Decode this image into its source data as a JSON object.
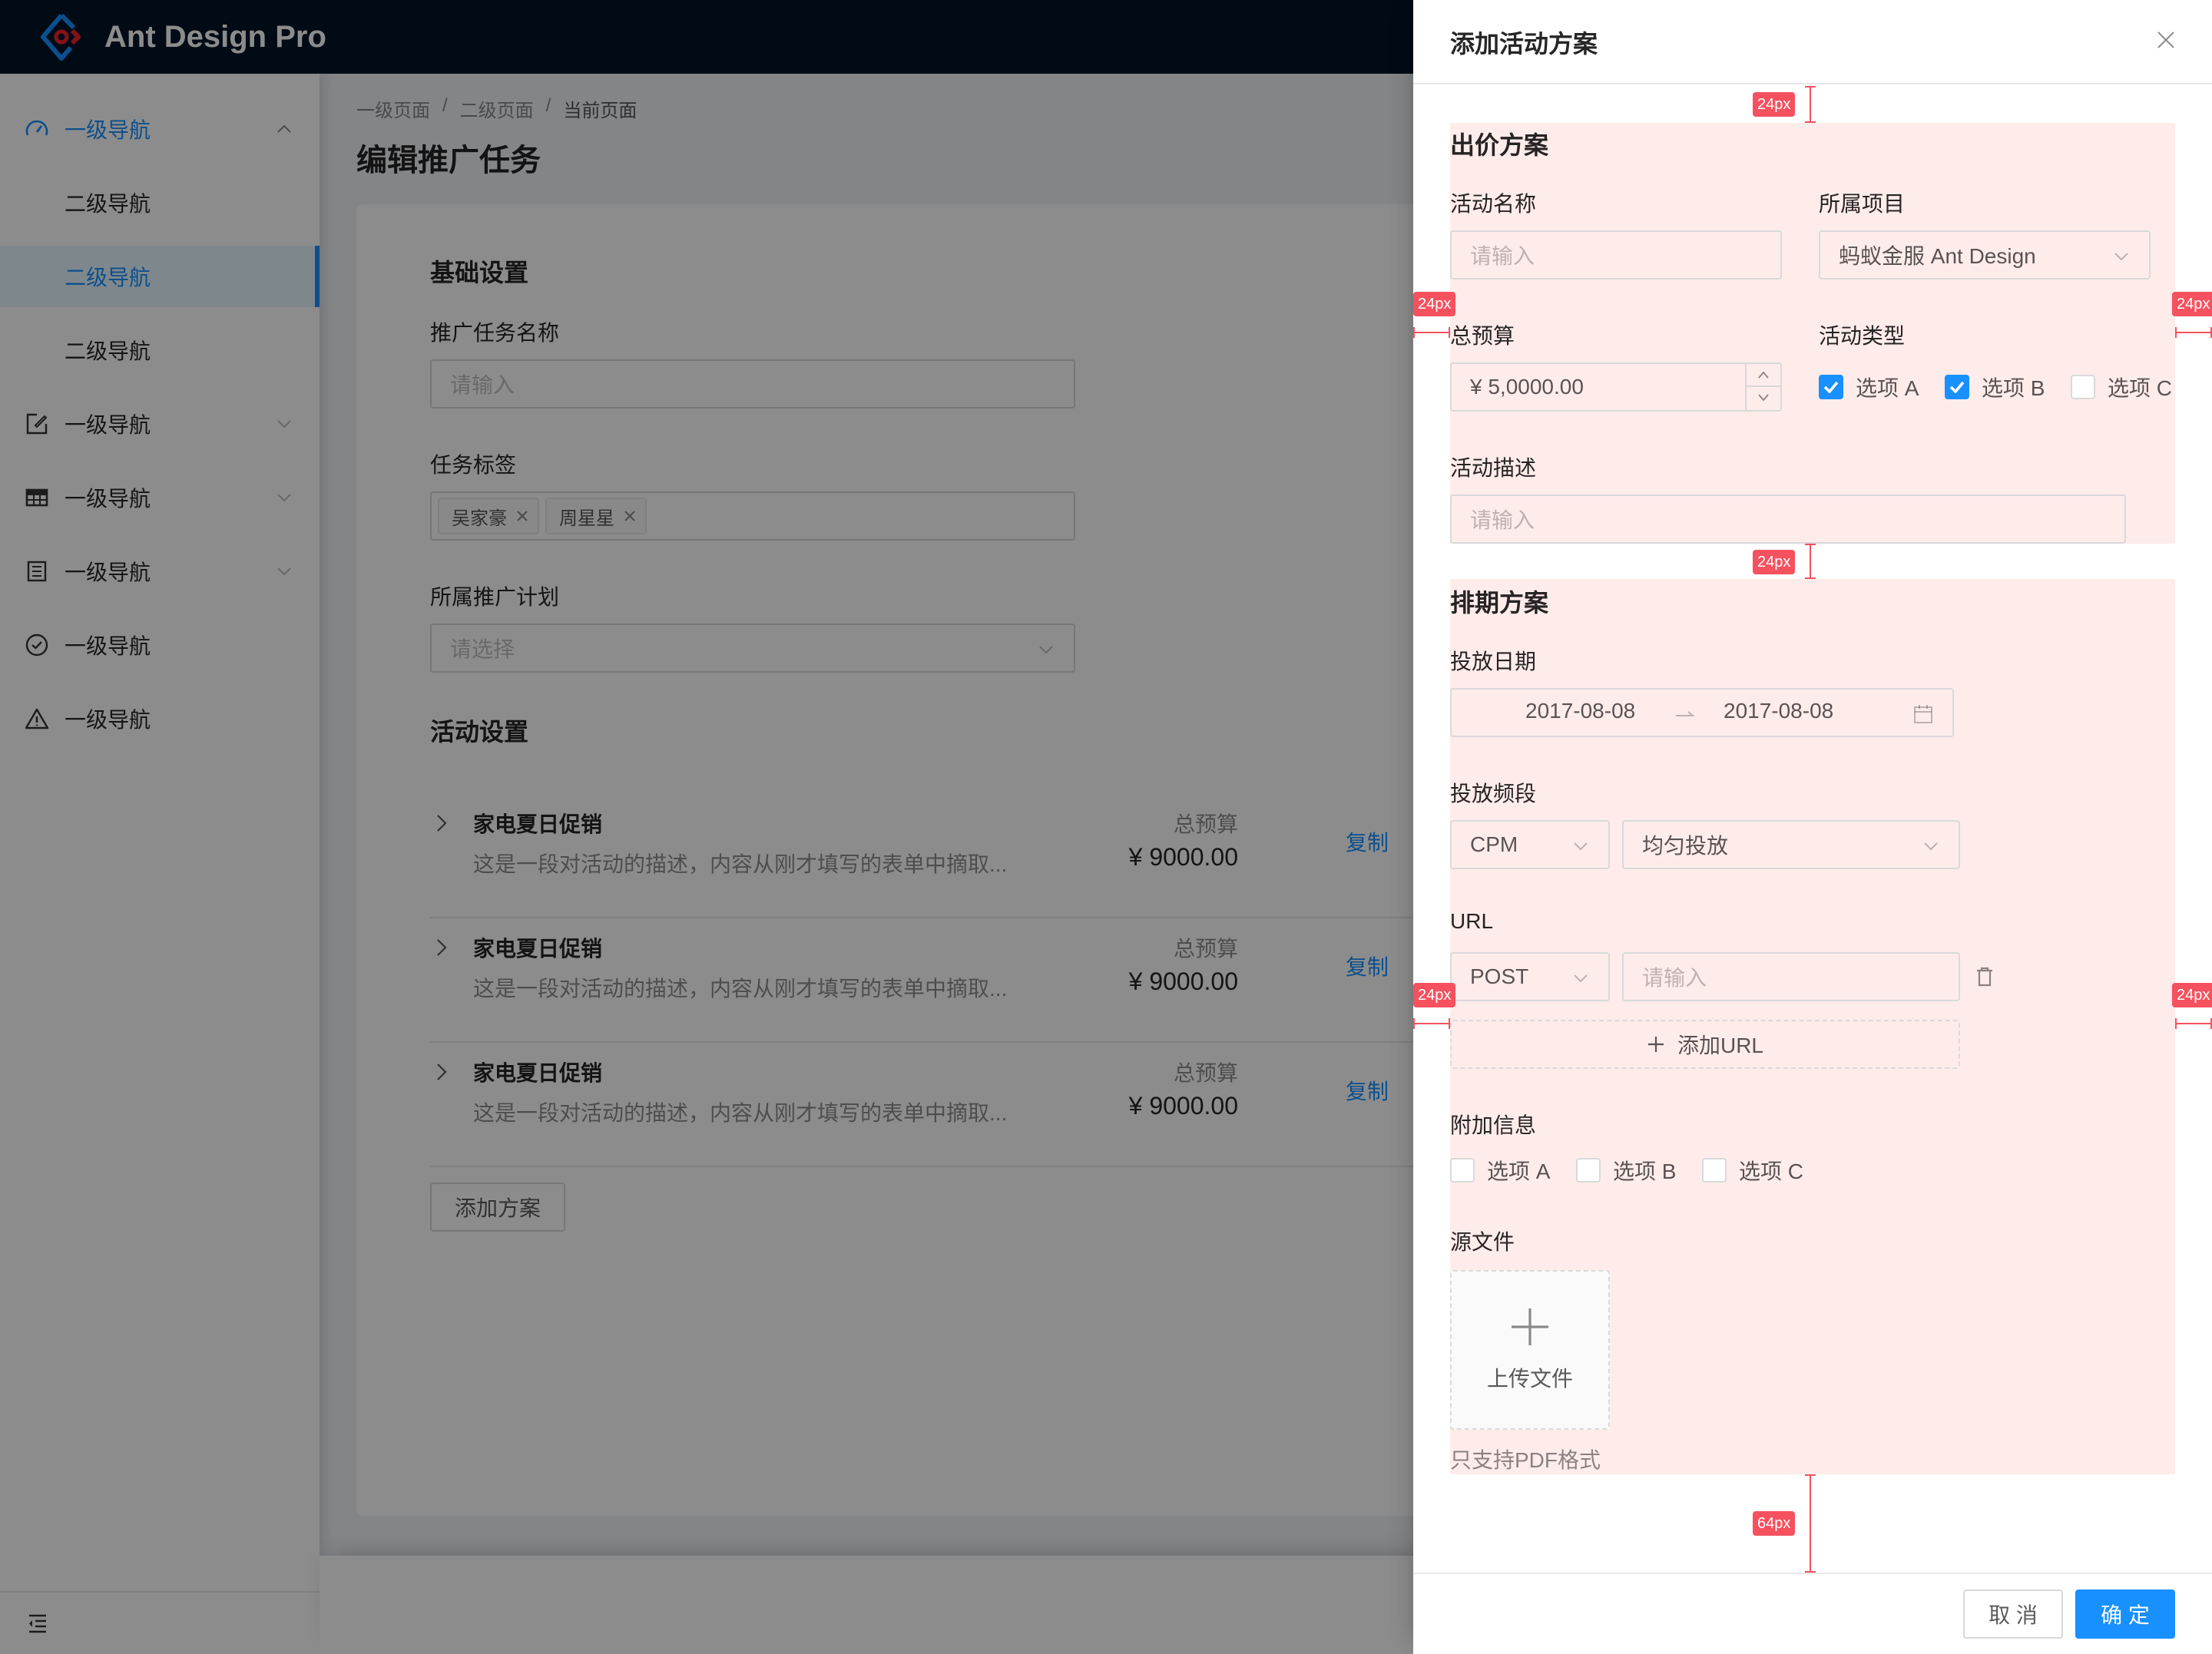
{
  "app": {
    "title": "Ant Design Pro"
  },
  "sidebar": {
    "items": [
      {
        "label": "一级导航",
        "icon": "dashboard-icon",
        "expanded": true,
        "active": true
      },
      {
        "label": "二级导航",
        "level": 2
      },
      {
        "label": "二级导航",
        "level": 2,
        "selected": true
      },
      {
        "label": "二级导航",
        "level": 2
      },
      {
        "label": "一级导航",
        "icon": "form-icon",
        "expandable": true
      },
      {
        "label": "一级导航",
        "icon": "table-icon",
        "expandable": true
      },
      {
        "label": "一级导航",
        "icon": "profile-icon",
        "expandable": true
      },
      {
        "label": "一级导航",
        "icon": "check-circle-icon"
      },
      {
        "label": "一级导航",
        "icon": "warning-icon"
      }
    ],
    "collapse_icon": "menu-fold-icon"
  },
  "breadcrumb": [
    "一级页面",
    "二级页面",
    "当前页面"
  ],
  "breadcrumb_separator": "/",
  "page": {
    "title": "编辑推广任务",
    "basic_section": "基础设置",
    "task_name_label": "推广任务名称",
    "task_name_placeholder": "请输入",
    "tags_label": "任务标签",
    "tags": [
      "吴家豪",
      "周星星"
    ],
    "plan_label": "所属推广计划",
    "plan_placeholder": "请选择",
    "activity_section": "活动设置",
    "activities": [
      {
        "title": "家电夏日促销",
        "desc": "这是一段对活动的描述，内容从刚才填写的表单中摘取...",
        "budget_label": "总预算",
        "budget": "¥ 9000.00",
        "action": "复制"
      },
      {
        "title": "家电夏日促销",
        "desc": "这是一段对活动的描述，内容从刚才填写的表单中摘取...",
        "budget_label": "总预算",
        "budget": "¥ 9000.00",
        "action": "复制"
      },
      {
        "title": "家电夏日促销",
        "desc": "这是一段对活动的描述，内容从刚才填写的表单中摘取...",
        "budget_label": "总预算",
        "budget": "¥ 9000.00",
        "action": "复制"
      }
    ],
    "add_plan_button": "添加方案"
  },
  "drawer": {
    "title": "添加活动方案",
    "bid_section": "出价方案",
    "activity_name_label": "活动名称",
    "activity_name_placeholder": "请输入",
    "project_label": "所属项目",
    "project_value": "蚂蚁金服 Ant Design",
    "budget_label": "总预算",
    "budget_value": "¥ 5,0000.00",
    "type_label": "活动类型",
    "type_options": [
      {
        "label": "选项 A",
        "checked": true
      },
      {
        "label": "选项 B",
        "checked": true
      },
      {
        "label": "选项 C",
        "checked": false
      }
    ],
    "desc_label": "活动描述",
    "desc_placeholder": "请输入",
    "schedule_section": "排期方案",
    "date_label": "投放日期",
    "date_start": "2017-08-08",
    "date_end": "2017-08-08",
    "freq_label": "投放频段",
    "freq_type": "CPM",
    "freq_mode": "均匀投放",
    "url_label": "URL",
    "url_method": "POST",
    "url_placeholder": "请输入",
    "add_url_button": "添加URL",
    "extra_label": "附加信息",
    "extra_options": [
      {
        "label": "选项 A",
        "checked": false
      },
      {
        "label": "选项 B",
        "checked": false
      },
      {
        "label": "选项 C",
        "checked": false
      }
    ],
    "file_label": "源文件",
    "upload_text": "上传文件",
    "file_hint": "只支持PDF格式",
    "cancel_button": "取 消",
    "ok_button": "确 定"
  },
  "redlines": {
    "top_gap": "24px",
    "left_gap_1": "24px",
    "right_gap_1": "24px",
    "section_gap": "24px",
    "left_gap_2": "24px",
    "right_gap_2": "24px",
    "bottom_gap": "64px"
  },
  "colors": {
    "primary": "#1890ff",
    "header_bg": "#001529",
    "redline": "#f5515f",
    "redline_fill": "#feeceb"
  }
}
